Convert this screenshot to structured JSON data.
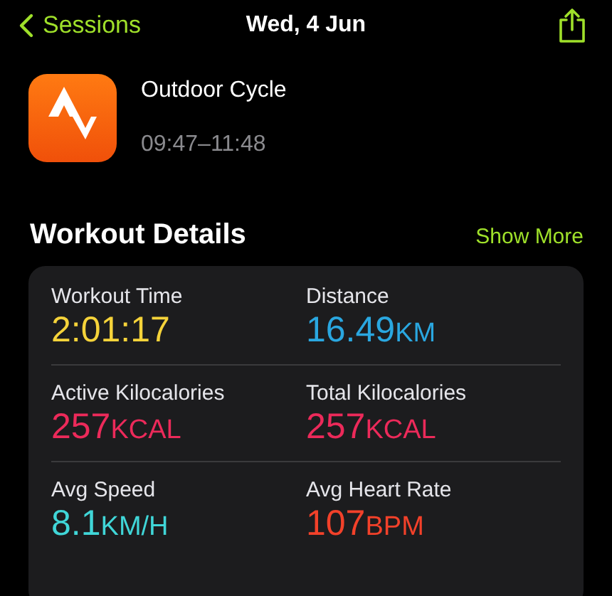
{
  "nav": {
    "back": "Sessions",
    "title": "Wed, 4 Jun"
  },
  "workout": {
    "name": "Outdoor Cycle",
    "time": "09:47–11:48"
  },
  "section": {
    "title": "Workout Details",
    "action": "Show More"
  },
  "metrics": [
    {
      "label": "Workout Time",
      "value": "2:01:17",
      "color": "#f5d33a"
    },
    {
      "label": "Distance",
      "value": "16.49",
      "unit": "KM",
      "color": "#2aa7e0"
    },
    {
      "label": "Active Kilocalories",
      "value": "257",
      "unit": "KCAL",
      "color": "#ec2a5a"
    },
    {
      "label": "Total Kilocalories",
      "value": "257",
      "unit": "KCAL",
      "color": "#ec2a5a"
    },
    {
      "label": "Avg Speed",
      "value": "8.1",
      "unit": "KM/H",
      "color": "#40d6d8"
    },
    {
      "label": "Avg Heart Rate",
      "value": "107",
      "unit": "BPM",
      "color": "#f2412a"
    }
  ]
}
